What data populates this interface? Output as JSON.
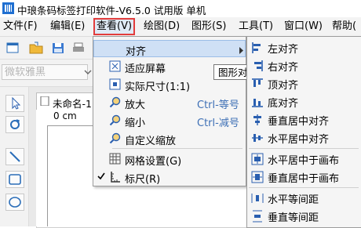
{
  "window": {
    "title": "中琅条码标签打印软件-V6.5.0 试用版 单机"
  },
  "menubar": {
    "items": [
      {
        "label": "文件(F)"
      },
      {
        "label": "编辑(E)"
      },
      {
        "label": "查看(V)"
      },
      {
        "label": "绘图(D)"
      },
      {
        "label": "图形(S)"
      },
      {
        "label": "工具(T)"
      },
      {
        "label": "窗口(W)"
      },
      {
        "label": "帮助("
      }
    ]
  },
  "toolbar": {
    "font_placeholder": "微软雅黑"
  },
  "document": {
    "tab_label": "未命名-1",
    "ruler_unit": "0 cm"
  },
  "view_menu": {
    "items": [
      {
        "label": "对齐",
        "shortcut": ""
      },
      {
        "label": "适应屏幕",
        "shortcut": ""
      },
      {
        "label": "实际尺寸(1:1)",
        "shortcut": ""
      },
      {
        "label": "放大",
        "shortcut": "Ctrl-等号"
      },
      {
        "label": "缩小",
        "shortcut": "Ctrl-减号"
      },
      {
        "label": "自定义缩放",
        "shortcut": ""
      },
      {
        "label": "网格设置(G)",
        "shortcut": ""
      },
      {
        "label": "标尺(R)",
        "shortcut": ""
      }
    ]
  },
  "tooltip": {
    "text": "图形对齐"
  },
  "align_menu": {
    "items": [
      {
        "label": "左对齐"
      },
      {
        "label": "右对齐"
      },
      {
        "label": "顶对齐"
      },
      {
        "label": "底对齐"
      },
      {
        "label": "垂直居中对齐"
      },
      {
        "label": "水平居中对齐"
      },
      {
        "label": "水平居中于画布"
      },
      {
        "label": "垂直居中于画布"
      },
      {
        "label": "水平等间距"
      },
      {
        "label": "垂直等间距"
      }
    ]
  },
  "colors": {
    "highlight_border": "#e23c3c",
    "menu_highlight": "#cfe0f5",
    "shortcut_text": "#3d6fb5"
  }
}
